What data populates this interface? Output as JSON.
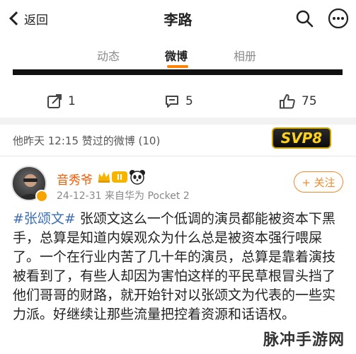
{
  "header": {
    "back_label": "返回",
    "title": "李路"
  },
  "tabs": [
    {
      "label": "动态"
    },
    {
      "label": "微博"
    },
    {
      "label": "相册"
    }
  ],
  "actions": {
    "share_count": "1",
    "comment_count": "5",
    "like_count": "75"
  },
  "liked_section": {
    "text": "他昨天 12:15 赞过的微博 (10)",
    "logo_text": "SVP8"
  },
  "post": {
    "username": "音秀爷",
    "level_badge": "II",
    "meta": "24-12-31  来自华为 Pocket 2",
    "follow_label": "+ 关注",
    "hashtag": "#张颂文#",
    "body": " 张颂文这么一个低调的演员都能被资本下黑手，总算是知道内娱观众为什么总是被资本强行喂屎了。一个在行业内苦了几十年的演员，总算是靠着演技被看到了，有些人却因为害怕这样的平民草根冒头挡了他们哥哥的财路，就开始针对以张颂文为代表的一些实力派。好继续让那些流量把控着资源和话语权。"
  },
  "watermark": "脉冲手游网",
  "colors": {
    "accent": "#ff8200",
    "username": "#f05a00",
    "hashtag": "#3a6fb7"
  }
}
